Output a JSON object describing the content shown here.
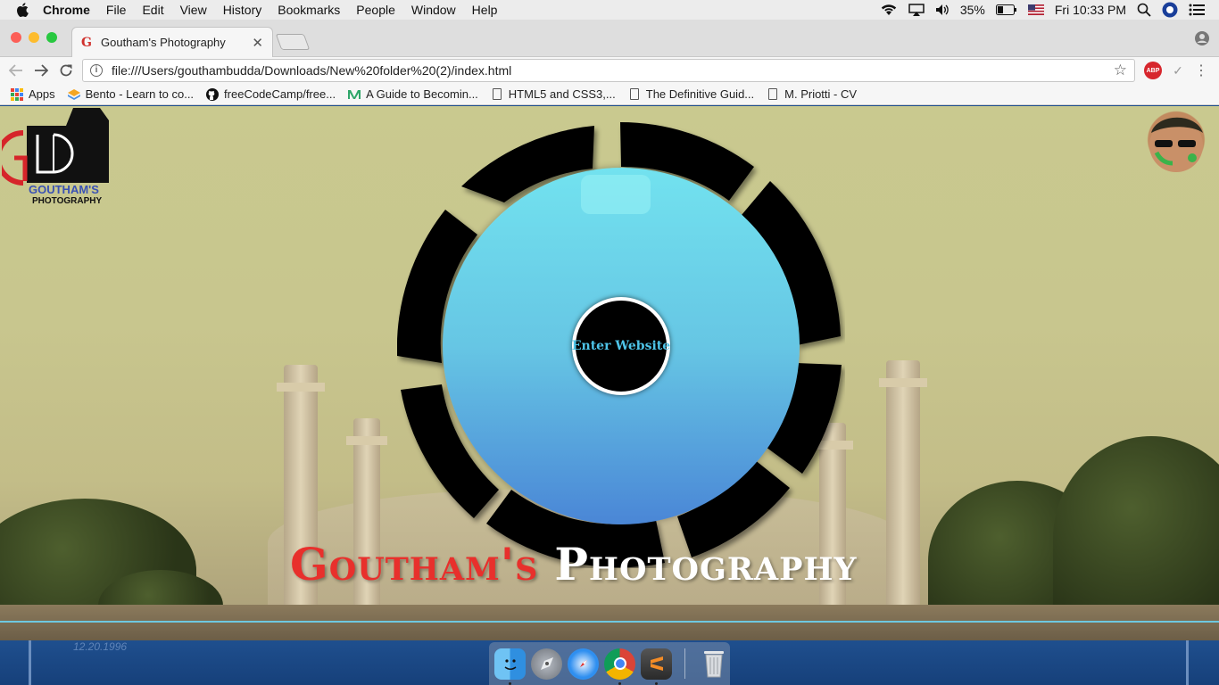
{
  "menubar": {
    "app_name": "Chrome",
    "items": [
      "File",
      "Edit",
      "View",
      "History",
      "Bookmarks",
      "People",
      "Window",
      "Help"
    ],
    "battery": "35%",
    "clock": "Fri 10:33 PM"
  },
  "tab": {
    "title": "Goutham's Photography",
    "favicon": "G"
  },
  "omnibox": {
    "url": "file:///Users/gouthambudda/Downloads/New%20folder%20(2)/index.html"
  },
  "extensions": {
    "abp_label": "ABP"
  },
  "bookmarks": [
    "Apps",
    "Bento - Learn to co...",
    "freeCodeCamp/free...",
    "A Guide to Becomin...",
    "HTML5 and CSS3,...",
    "The Definitive Guid...",
    "M. Priotti - CV"
  ],
  "site": {
    "logo_text_top": "GOUTHAM'S",
    "logo_text_bottom": "PHOTOGRAPHY",
    "logo_monogram": "G",
    "enter_button": "Enter Website",
    "brand_part1": "Goutham's",
    "brand_part2": "Photography"
  },
  "desktop": {
    "date_label": "12.20.1996"
  },
  "dock": [
    "finder-icon",
    "launchpad-icon",
    "safari-icon",
    "chrome-icon",
    "sublime-text-icon",
    "trash-icon"
  ],
  "colors": {
    "accent_cyan": "#6ec7e0",
    "brand_red": "#e8302c",
    "enter_text": "#4ec4e8"
  }
}
